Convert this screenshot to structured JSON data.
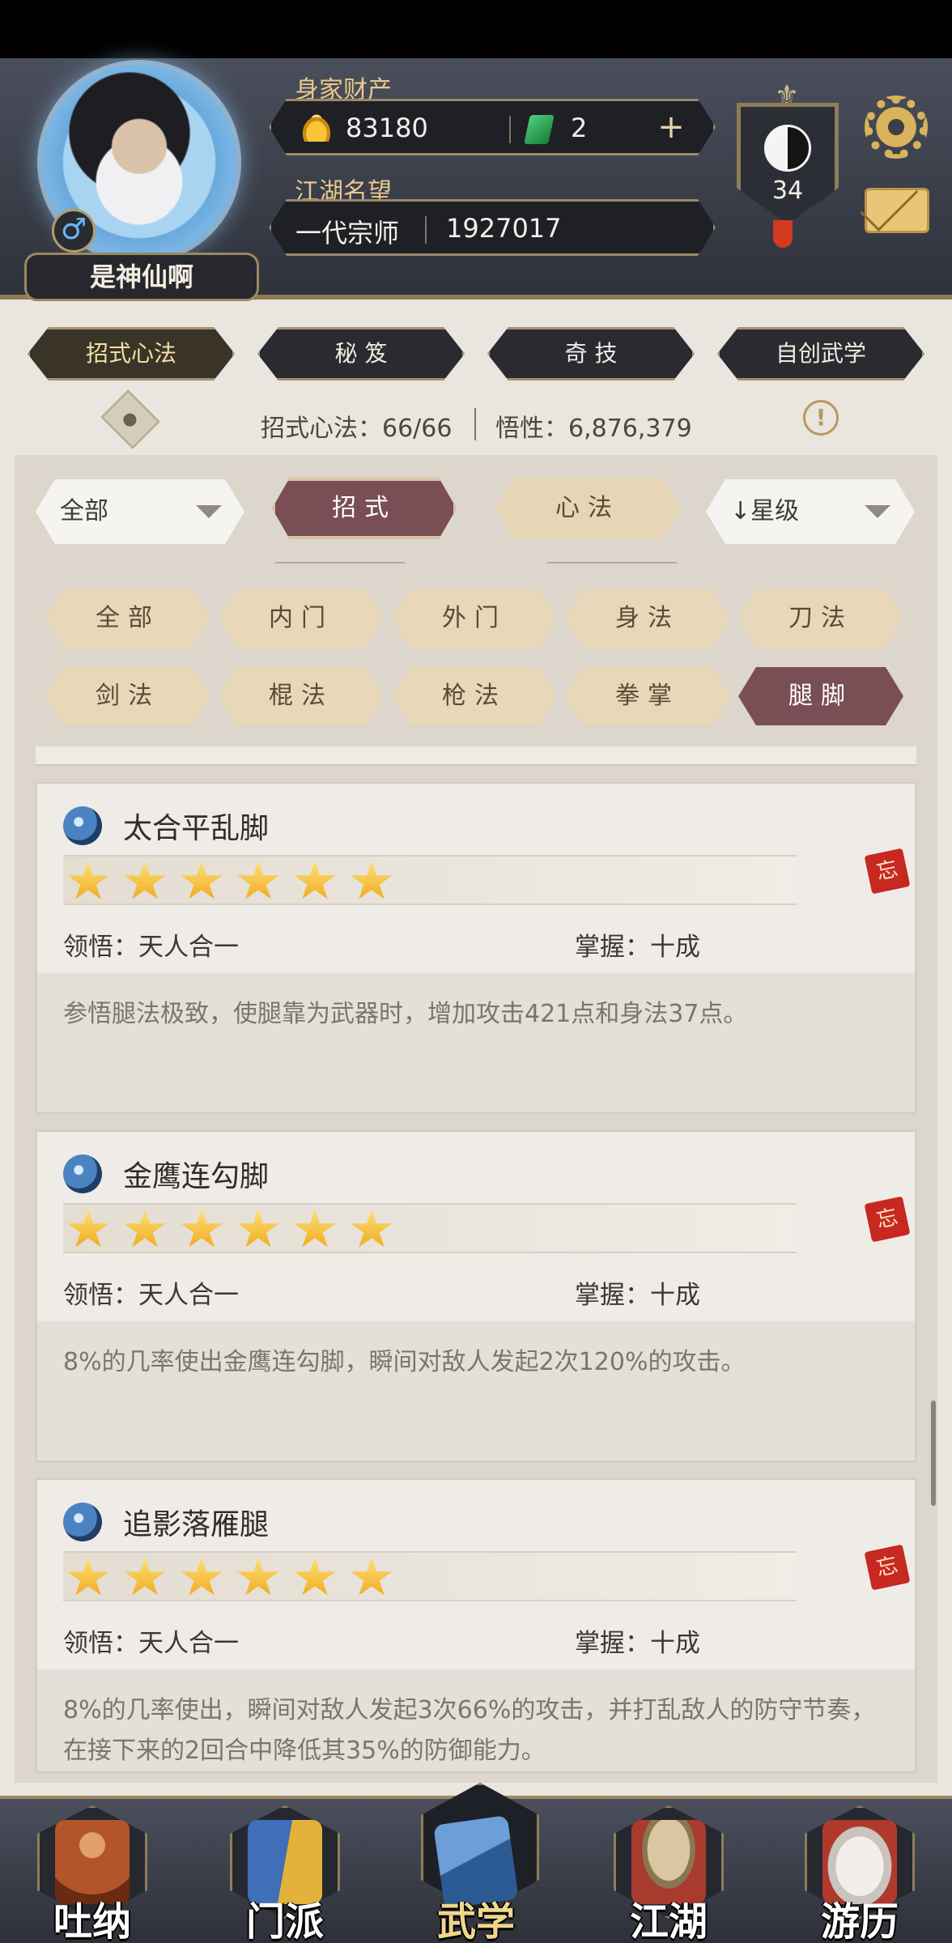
{
  "header": {
    "player_name": "是神仙啊",
    "gender_symbol": "♂",
    "wealth_label": "身家财产",
    "gold": "83180",
    "jade": "2",
    "plus": "+",
    "fame_label": "江湖名望",
    "title": "一代宗师",
    "fame_value": "1927017",
    "level": "34",
    "fleur": "⚜"
  },
  "main_tabs": [
    {
      "label": "招式心法",
      "active": true
    },
    {
      "label": "秘 笈",
      "active": false
    },
    {
      "label": "奇 技",
      "active": false
    },
    {
      "label": "自创武学",
      "active": false
    }
  ],
  "stats": {
    "moves": "招式心法：66/66",
    "insight": "悟性：6,876,379",
    "info": "!"
  },
  "filters": {
    "scope_select": "全部",
    "type_moves": "招式",
    "type_methods": "心法",
    "sort_select": "↓星级",
    "chips": [
      "全部",
      "内门",
      "外门",
      "身法",
      "刀法",
      "剑法",
      "棍法",
      "枪法",
      "拳掌",
      "腿脚"
    ],
    "active_chip": "腿脚"
  },
  "skills": [
    {
      "name": "太合平乱脚",
      "stars": 6,
      "comprehension": "领悟：天人合一",
      "mastery": "掌握：十成",
      "description": "参悟腿法极致，使腿靠为武器时，增加攻击421点和身法37点。",
      "forget": "忘"
    },
    {
      "name": "金鹰连勾脚",
      "stars": 6,
      "comprehension": "领悟：天人合一",
      "mastery": "掌握：十成",
      "description": "8%的几率使出金鹰连勾脚，瞬间对敌人发起2次120%的攻击。",
      "forget": "忘"
    },
    {
      "name": "追影落雁腿",
      "stars": 6,
      "comprehension": "领悟：天人合一",
      "mastery": "掌握：十成",
      "description": "8%的几率使出，瞬间对敌人发起3次66%的攻击，并打乱敌人的防守节奏，在接下来的2回合中降低其35%的防御能力。",
      "forget": "忘"
    }
  ],
  "bottom_nav": [
    {
      "label": "吐纳",
      "active": false,
      "color": "#b4542a"
    },
    {
      "label": "门派",
      "active": false,
      "color": "#3e6fb8"
    },
    {
      "label": "武学",
      "active": true,
      "color": "#3d6ea8"
    },
    {
      "label": "江湖",
      "active": false,
      "color": "#a83a2e"
    },
    {
      "label": "游历",
      "active": false,
      "color": "#c9c4bd"
    }
  ]
}
